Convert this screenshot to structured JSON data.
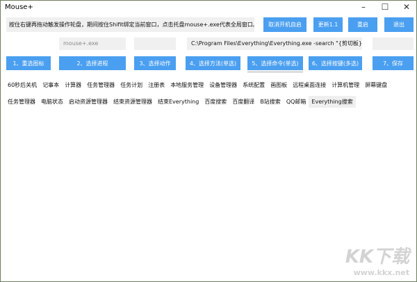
{
  "window": {
    "title": "Mouse+",
    "minimize": "–",
    "maximize": "☐",
    "close": "✕"
  },
  "hint": "按住右键再拖动触发操作轮盘，期间按住Shifit绑定当前窗口，点击托盘mouse+.exe代表全局窗口。",
  "top_buttons": [
    "取消开机自启",
    "更新1.1",
    "重启",
    "退出"
  ],
  "inputs": {
    "process": "mouse+.exe",
    "action": "",
    "command": "C:\\Program Files\\Everything\\Everything.exe -search \"{剪切板}\"",
    "keys": ""
  },
  "steps": [
    "1、重选图标",
    "2、选择进程",
    "3、选择动作",
    "4、选择方法(单选)",
    "5、选择命令(单选)",
    "6、选择按键(多选)",
    "7、保存"
  ],
  "commands_row1": [
    "60秒后关机",
    "记事本",
    "计算器",
    "任务管理器",
    "任务计划",
    "注册表",
    "本地服务管理",
    "设备管理器",
    "系统配置",
    "画图板",
    "远程桌面连接",
    "计算机管理",
    "屏幕键盘"
  ],
  "commands_row2": [
    "任务管理器",
    "电脑状态",
    "启动资源管理器",
    "结束资源管理器",
    "结束Everything",
    "百度搜索",
    "百度翻译",
    "B站搜索",
    "QQ邮箱",
    "Everything搜索"
  ],
  "watermark": {
    "logo": "KK下载",
    "url": "www.kkx.net"
  }
}
